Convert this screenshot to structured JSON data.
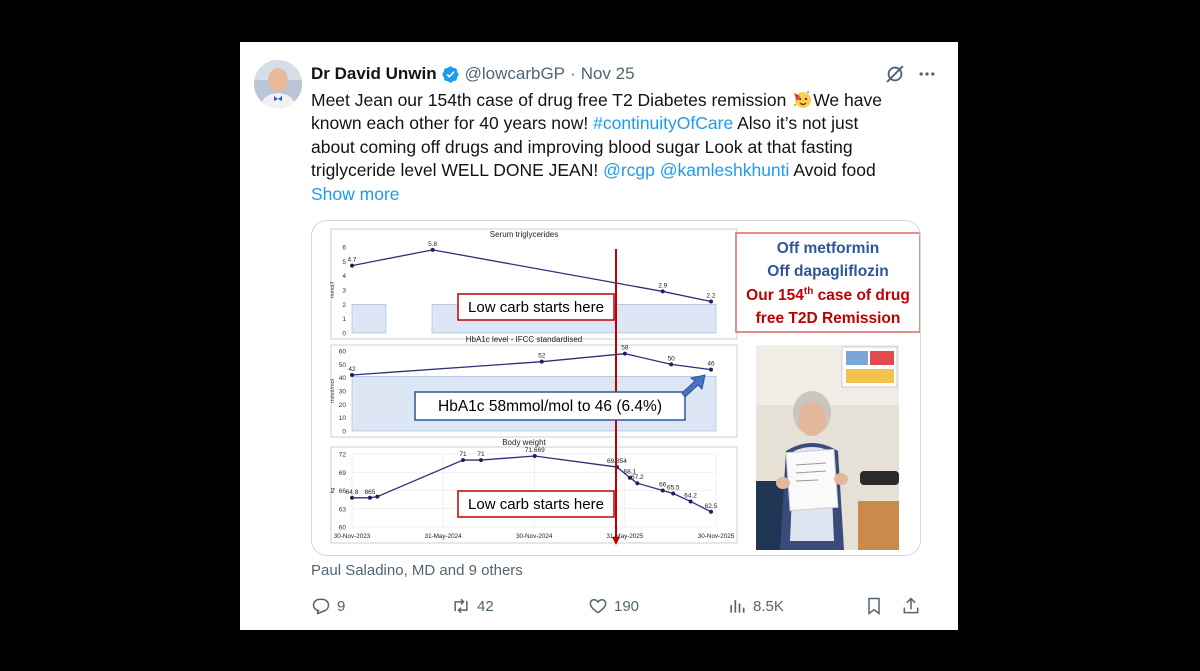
{
  "tweet": {
    "author_name": "Dr David Unwin",
    "handle": "@lowcarbGP",
    "separator": "·",
    "date": "Nov 25",
    "text_lines": [
      [
        "Meet Jean our 154th case of drug free T2 Diabetes remission ",
        "🥳",
        "We have"
      ],
      "known each other for 40 years now! ",
      "about coming off drugs and improving blood sugar Look at that fasting",
      "triglyceride level WELL DONE JEAN! "
    ],
    "text": {
      "l1a": "Meet Jean our 154th case of drug free T2 Diabetes remission",
      "l1b": "We have",
      "l2a": "known each other for 40 years now!",
      "l2link": "#continuityOfCare",
      "l2b": "Also it’s not just",
      "l3": "about coming off drugs and improving blood sugar Look at that fasting",
      "l4a": "triglyceride level WELL DONE JEAN!",
      "l4link1": "@rcgp",
      "l4link2": "@kamleshkhunti",
      "l4b": "Avoid food"
    },
    "show_more": "Show more",
    "liked_by": "Paul Saladino, MD and 9 others",
    "icons": {
      "verified": "verified-badge-icon",
      "grok": "grok-icon",
      "more": "more-dots-icon"
    },
    "colors": {
      "link": "#1d9bf0",
      "verified": "#1d9bf0",
      "text": "#0f1419",
      "muted": "#536471"
    }
  },
  "actions": {
    "reply_count": "9",
    "retweet_count": "42",
    "like_count": "190",
    "views_count": "8.5K"
  },
  "image": {
    "callout": {
      "line1": "Off metformin",
      "line2": "Off dapagliflozin",
      "line3_pre": "Our 154",
      "line3_sup": "th",
      "line3_post": " case of drug",
      "line4": "free T2D Remission",
      "color_blue": "#2f5597",
      "color_red": "#c00000"
    },
    "label_lowcarb_1": "Low carb starts here",
    "label_lowcarb_2": "Low carb starts here",
    "label_hba1c": "HbA1c 58mmol/mol to 46 (6.4%)",
    "x_dates": [
      "30-Nov-2023",
      "31-May-2024",
      "30-Nov-2024",
      "31-May-2025",
      "30-Nov-2025"
    ]
  },
  "chart_data": [
    {
      "type": "line",
      "title": "Serum triglycerides",
      "ylabel": "mmol/l",
      "ylim": [
        0,
        6
      ],
      "yticks": [
        0,
        1,
        2,
        3,
        4,
        5,
        6
      ],
      "x": [
        "30-Nov-2023",
        "31-May-2024",
        "30-Nov-2025 approx 2025-08",
        "2025-11"
      ],
      "points": [
        {
          "x": "2023-11-30",
          "y": 4.7,
          "label": "4.7"
        },
        {
          "x": "2024-05-10",
          "y": 5.8,
          "label": "5.8"
        },
        {
          "x": "2025-08-15",
          "y": 2.9,
          "label": "2.9"
        },
        {
          "x": "2025-11-20",
          "y": 2.2,
          "label": "2.2"
        }
      ],
      "reference_band": [
        0,
        2
      ]
    },
    {
      "type": "line",
      "title": "HbA1c level - IFCC standardised",
      "ylabel": "mmol/mol",
      "ylim": [
        0,
        60
      ],
      "yticks": [
        0,
        10,
        20,
        30,
        40,
        50,
        60
      ],
      "points": [
        {
          "x": "2023-11-30",
          "y": 42,
          "label": "42"
        },
        {
          "x": "2024-12-15",
          "y": 52,
          "label": "52"
        },
        {
          "x": "2025-05-31",
          "y": 58,
          "label": "58"
        },
        {
          "x": "2025-09-01",
          "y": 50,
          "label": "50"
        },
        {
          "x": "2025-11-20",
          "y": 46,
          "label": "46"
        }
      ],
      "reference_band": [
        0,
        41
      ]
    },
    {
      "type": "line",
      "title": "Body weight",
      "ylabel": "kg",
      "ylim": [
        60,
        72
      ],
      "yticks": [
        60,
        63,
        66,
        69,
        72
      ],
      "points": [
        {
          "x": "2023-11-30",
          "y": 64.8,
          "label": "64.8"
        },
        {
          "x": "2024-01-05",
          "y": 64.8,
          "label": "865"
        },
        {
          "x": "2024-01-20",
          "y": 65.0,
          "label": ""
        },
        {
          "x": "2024-07-10",
          "y": 71,
          "label": "71"
        },
        {
          "x": "2024-08-15",
          "y": 71,
          "label": "71"
        },
        {
          "x": "2024-12-01",
          "y": 71.669,
          "label": "71.669"
        },
        {
          "x": "2025-05-15",
          "y": 69.854,
          "label": "69.854"
        },
        {
          "x": "2025-06-10",
          "y": 68.1,
          "label": "68.1"
        },
        {
          "x": "2025-06-25",
          "y": 67.2,
          "label": "67.2"
        },
        {
          "x": "2025-08-15",
          "y": 66,
          "label": "66"
        },
        {
          "x": "2025-09-05",
          "y": 65.5,
          "label": "65.5"
        },
        {
          "x": "2025-10-10",
          "y": 64.2,
          "label": "64.2"
        },
        {
          "x": "2025-11-20",
          "y": 62.5,
          "label": "62.5"
        }
      ]
    }
  ]
}
